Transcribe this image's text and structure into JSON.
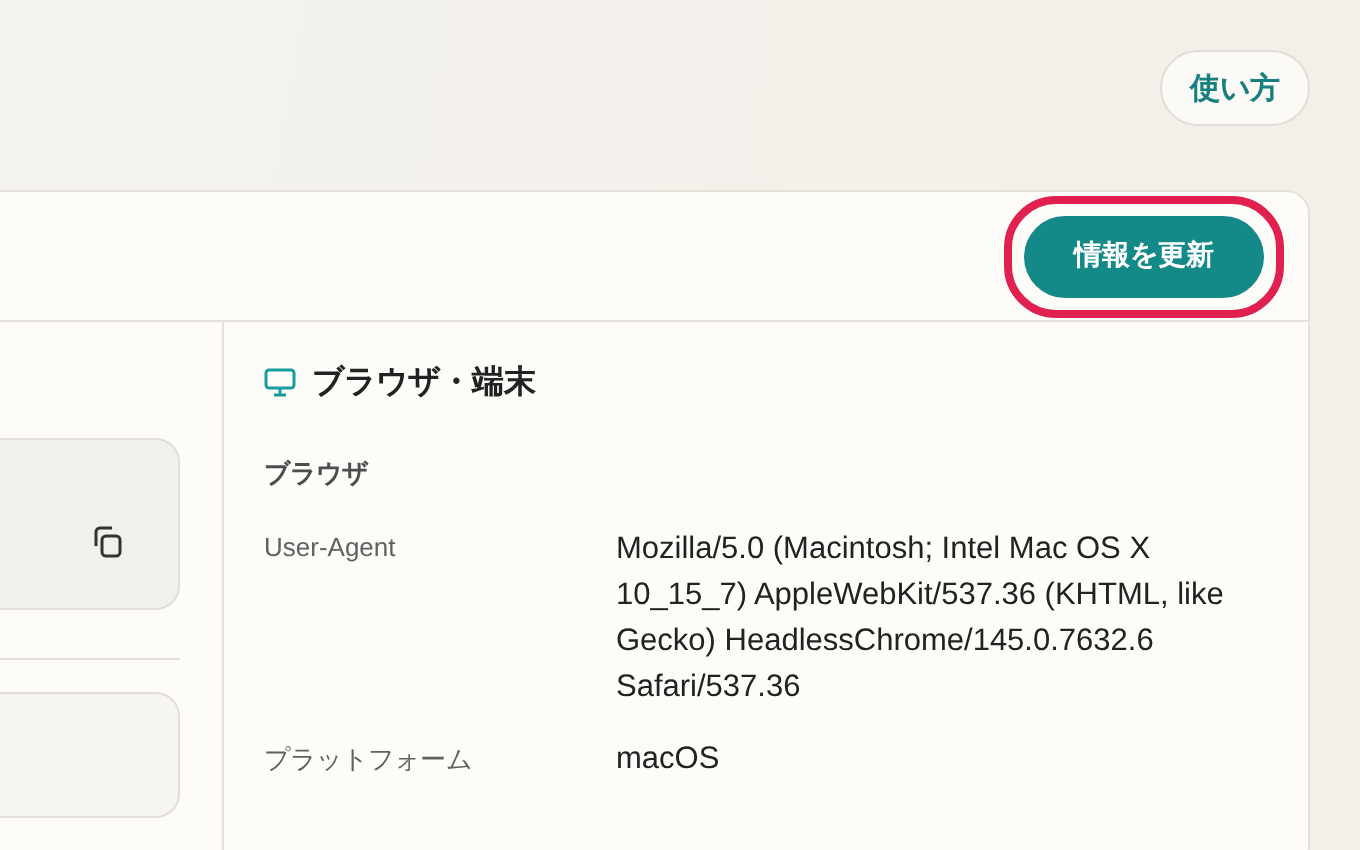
{
  "help_button": {
    "label": "使い方"
  },
  "toolbar": {
    "refresh_button": {
      "label": "情報を更新",
      "highlighted": true
    }
  },
  "left_panel": {
    "fields": [
      {
        "kind": "copyable"
      },
      {
        "kind": "plain"
      }
    ]
  },
  "right_panel": {
    "title": "ブラウザ・端末",
    "section": "ブラウザ",
    "rows": [
      {
        "label": "User-Agent",
        "value": "Mozilla/5.0 (Macintosh; Intel Mac OS X 10_15_7) AppleWebKit/537.36 (KHTML, like Gecko) HeadlessChrome/145.0.7632.6 Safari/537.36"
      },
      {
        "label": "プラットフォーム",
        "value": "macOS"
      }
    ]
  }
}
